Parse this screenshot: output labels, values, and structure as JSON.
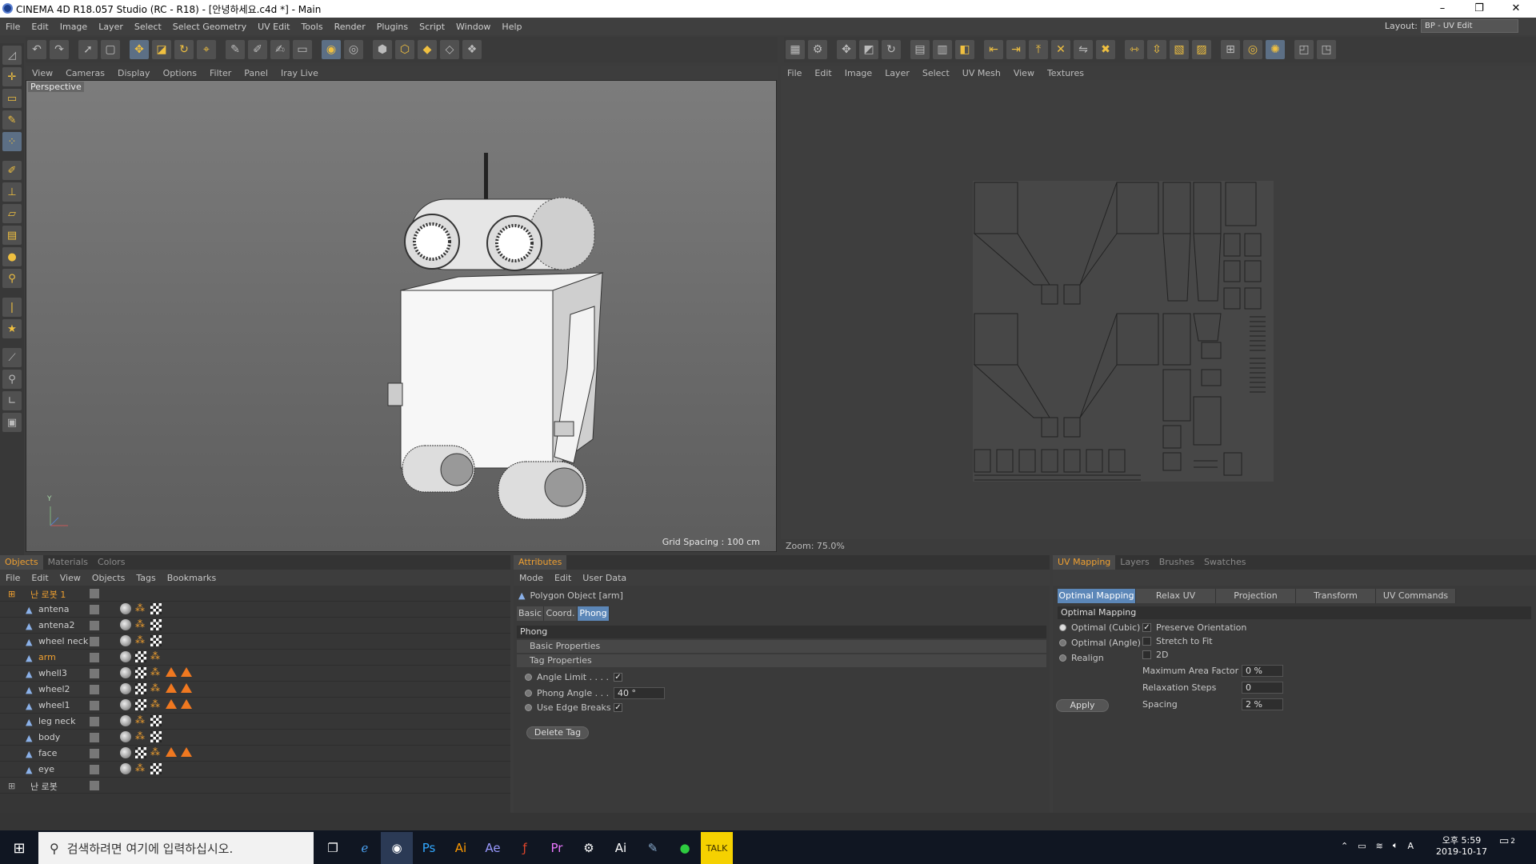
{
  "window": {
    "title": "CINEMA 4D R18.057 Studio (RC - R18) - [안녕하세요.c4d *] - Main",
    "minimize": "–",
    "restore": "❐",
    "close": "✕"
  },
  "menu": [
    "File",
    "Edit",
    "Image",
    "Layer",
    "Select",
    "Select Geometry",
    "UV Edit",
    "Tools",
    "Render",
    "Plugins",
    "Script",
    "Window",
    "Help"
  ],
  "layout": {
    "label": "Layout:",
    "value": "BP - UV Edit"
  },
  "viewport": {
    "menu": [
      "View",
      "Cameras",
      "Display",
      "Options",
      "Filter",
      "Panel",
      "Iray Live"
    ],
    "label": "Perspective",
    "grid_spacing": "Grid Spacing : 100 cm",
    "axis_y": "Y"
  },
  "uv_editor": {
    "menu": [
      "File",
      "Edit",
      "Image",
      "Layer",
      "Select",
      "UV Mesh",
      "View",
      "Textures"
    ],
    "zoom": "Zoom: 75.0%"
  },
  "objects_panel": {
    "tabs": [
      "Objects",
      "Materials",
      "Colors"
    ],
    "menu": [
      "File",
      "Edit",
      "View",
      "Objects",
      "Tags",
      "Bookmarks"
    ],
    "rows": [
      {
        "name": "난 로봇 1",
        "type": "null"
      },
      {
        "name": "antena",
        "type": "poly"
      },
      {
        "name": "antena2",
        "type": "poly"
      },
      {
        "name": "wheel neck",
        "type": "poly"
      },
      {
        "name": "arm",
        "type": "poly",
        "selected": true
      },
      {
        "name": "whell3",
        "type": "poly"
      },
      {
        "name": "wheel2",
        "type": "poly"
      },
      {
        "name": "wheel1",
        "type": "poly"
      },
      {
        "name": "leg neck",
        "type": "poly"
      },
      {
        "name": "body",
        "type": "poly"
      },
      {
        "name": "face",
        "type": "poly"
      },
      {
        "name": "eye",
        "type": "poly"
      },
      {
        "name": "난 로봇",
        "type": "null"
      }
    ]
  },
  "attributes": {
    "tab": "Attributes",
    "menu": [
      "Mode",
      "Edit",
      "User Data"
    ],
    "object": "Polygon Object [arm]",
    "subtabs": [
      "Basic",
      "Coord.",
      "Phong"
    ],
    "section": "Phong",
    "groups": [
      "Basic Properties",
      "Tag Properties"
    ],
    "fields": {
      "angle_limit": "Angle Limit . . . .",
      "phong_angle": "Phong Angle . . .",
      "phong_angle_value": "40 °",
      "use_edge_breaks": "Use Edge Breaks"
    },
    "delete_tag": "Delete Tag"
  },
  "uv_panel": {
    "tabs": [
      "UV Mapping",
      "Layers",
      "Brushes",
      "Swatches"
    ],
    "subtabs": [
      "Optimal Mapping",
      "Relax UV",
      "Projection",
      "Transform",
      "UV Commands"
    ],
    "section": "Optimal Mapping",
    "radios": [
      "Optimal (Cubic)",
      "Optimal (Angle)",
      "Realign"
    ],
    "checks": [
      "Preserve Orientation",
      "Stretch to Fit",
      "2D"
    ],
    "fields": [
      {
        "label": "Maximum Area Factor",
        "value": "0 %"
      },
      {
        "label": "Relaxation Steps",
        "value": "0"
      },
      {
        "label": "Spacing",
        "value": "2 %"
      }
    ],
    "apply": "Apply"
  },
  "taskbar": {
    "search_placeholder": "검색하려면 여기에 입력하십시오.",
    "ampm_time": "오후 5:59",
    "date": "2019-10-17",
    "lang": "A",
    "notifications": "2"
  }
}
